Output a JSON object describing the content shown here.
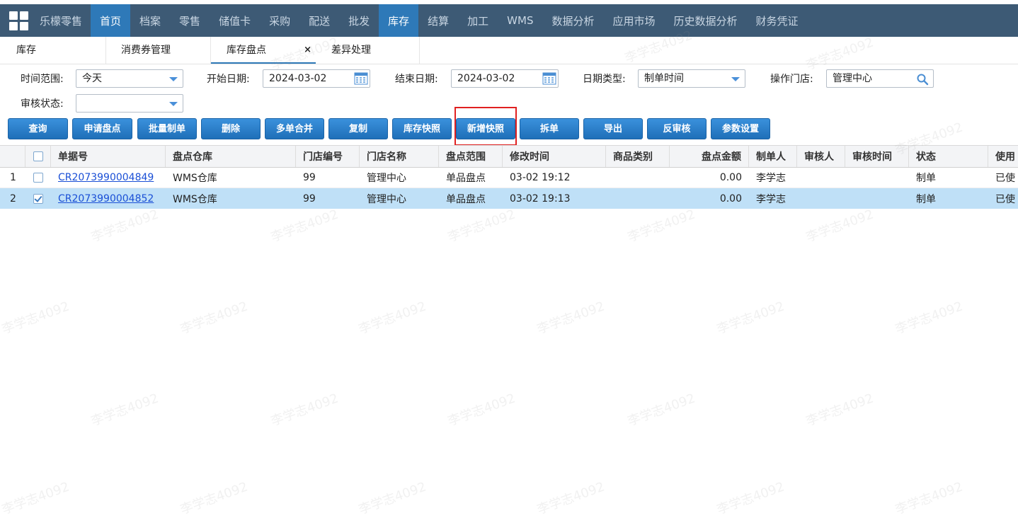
{
  "nav": {
    "brand": "乐檬零售",
    "items": [
      "首页",
      "档案",
      "零售",
      "储值卡",
      "采购",
      "配送",
      "批发",
      "库存",
      "结算",
      "加工",
      "WMS",
      "数据分析",
      "应用市场",
      "历史数据分析",
      "财务凭证"
    ],
    "active_items": [
      "首页",
      "库存"
    ]
  },
  "tabs": [
    {
      "label": "库存"
    },
    {
      "label": "消费券管理"
    },
    {
      "label": "库存盘点",
      "close": "×"
    },
    {
      "label": "差异处理"
    }
  ],
  "filters": {
    "time_range_label": "时间范围:",
    "time_range_value": "今天",
    "start_date_label": "开始日期:",
    "start_date_value": "2024-03-02",
    "end_date_label": "结束日期:",
    "end_date_value": "2024-03-02",
    "date_type_label": "日期类型:",
    "date_type_value": "制单时间",
    "store_label": "操作门店:",
    "store_value": "管理中心",
    "audit_status_label": "审核状态:",
    "audit_status_value": ""
  },
  "buttons": [
    "查询",
    "申请盘点",
    "批量制单",
    "删除",
    "多单合并",
    "复制",
    "库存快照",
    "新增快照",
    "拆单",
    "导出",
    "反审核",
    "参数设置"
  ],
  "highlighted_button": "新增快照",
  "table": {
    "columns": [
      "单据号",
      "盘点仓库",
      "门店编号",
      "门店名称",
      "盘点范围",
      "修改时间",
      "商品类别",
      "盘点金额",
      "制单人",
      "审核人",
      "审核时间",
      "状态",
      "使用"
    ],
    "rows": [
      {
        "index": "1",
        "checked": false,
        "cells": [
          "CR2073990004849",
          "WMS仓库",
          "99",
          "管理中心",
          "单品盘点",
          "03-02 19:12",
          "",
          "0.00",
          "李学志",
          "",
          "",
          "制单",
          "已使"
        ]
      },
      {
        "index": "2",
        "checked": true,
        "cells": [
          "CR2073990004852",
          "WMS仓库",
          "99",
          "管理中心",
          "单品盘点",
          "03-02 19:13",
          "",
          "0.00",
          "李学志",
          "",
          "",
          "制单",
          "已使"
        ]
      }
    ]
  },
  "watermark": "李学志4092",
  "colors": {
    "nav_bg": "#3d5a75",
    "nav_active": "#2e79b8",
    "button": "#2878c3",
    "row_selected": "#bfe0f7",
    "highlight": "#e02020",
    "link": "#1a4fd6"
  }
}
